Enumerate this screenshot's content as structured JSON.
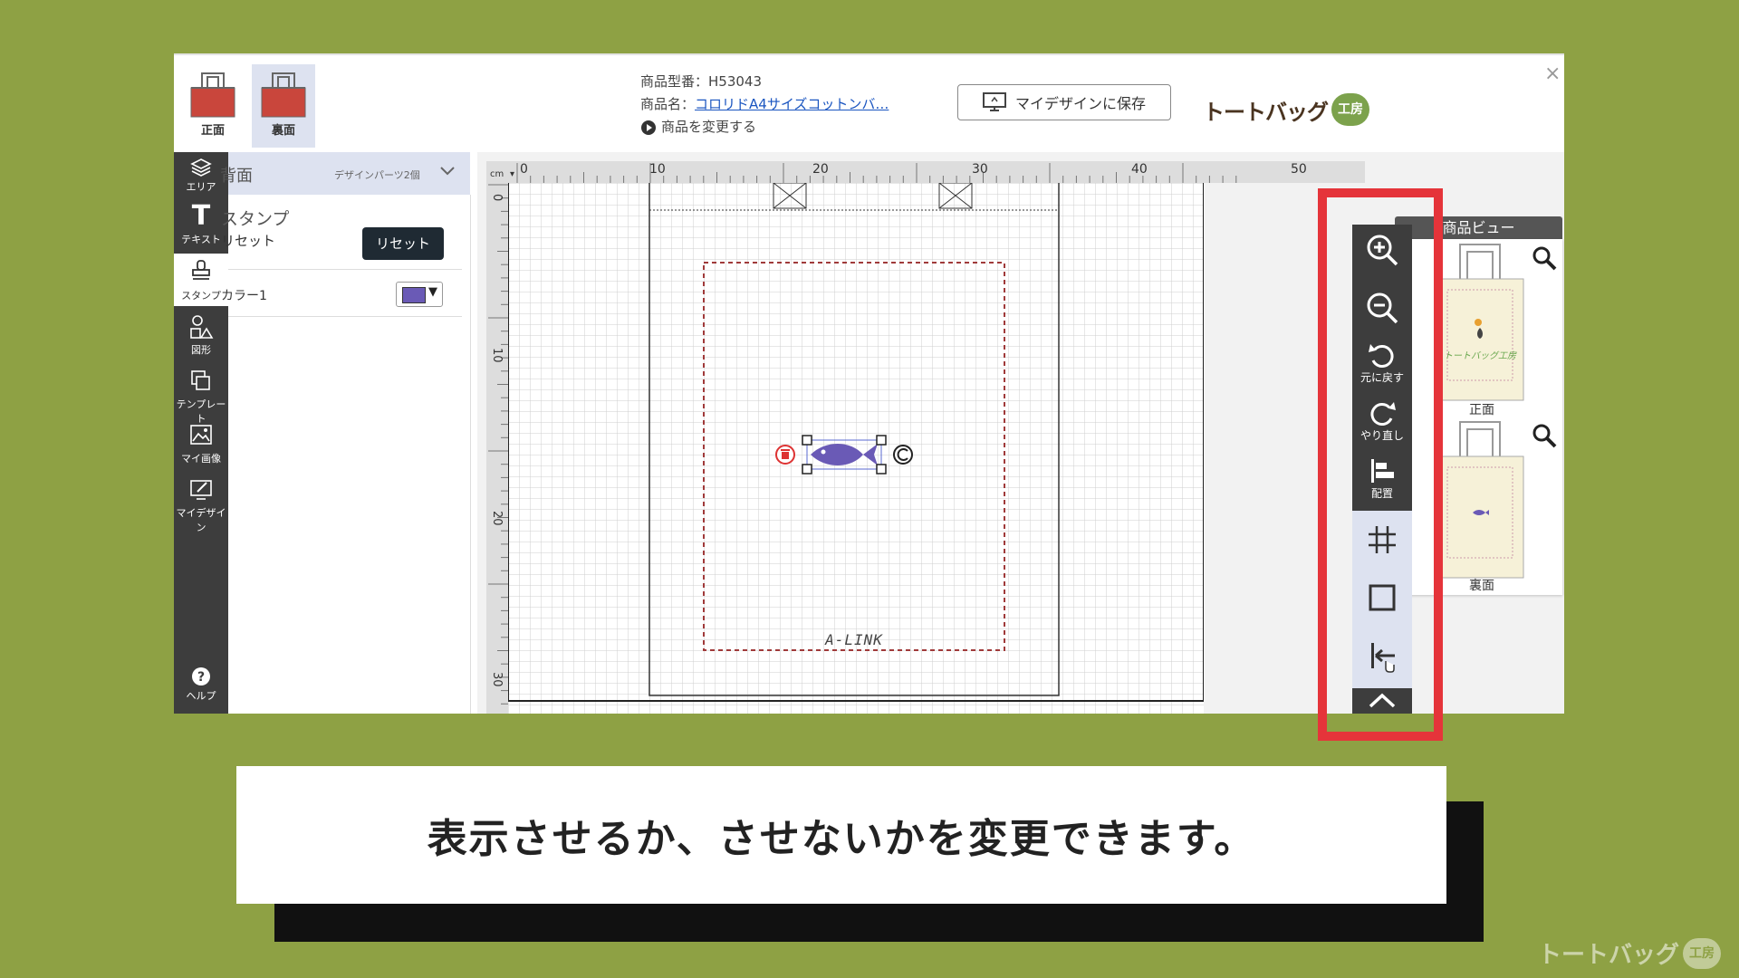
{
  "header": {
    "view_tabs": [
      {
        "label": "正面"
      },
      {
        "label": "裏面"
      }
    ],
    "product_code": "商品型番：H53043",
    "product_name_prefix": "商品名：",
    "product_name_link": "コロリドA4サイズコットンバ…",
    "change_product": "商品を変更する",
    "save_button": "マイデザインに保存",
    "logo_text": "トートバッグ",
    "logo_badge": "工房"
  },
  "iconbar": {
    "area": "エリア",
    "text": "テキスト",
    "stamp": "スタンプ",
    "shape": "図形",
    "template": "テンプレート",
    "my_image": "マイ画像",
    "my_design": "マイデザイン",
    "help": "ヘルプ"
  },
  "panel": {
    "area_title": "背面",
    "parts_count": "デザインパーツ2個",
    "section_title": "スタンプ",
    "reset_label": "リセット",
    "reset_button": "リセット",
    "color_label": "カラー1",
    "color_value": "#6a5ab6"
  },
  "canvas": {
    "unit": "cm",
    "ruler_h_ticks": [
      "0",
      "10",
      "20",
      "30",
      "40",
      "50"
    ],
    "ruler_v_ticks": [
      "0",
      "10",
      "20",
      "30"
    ],
    "bottom_text": "A-LINK"
  },
  "toolbar": {
    "undo": "元に戻す",
    "redo": "やり直し",
    "align": "配置"
  },
  "product_view": {
    "title": "商品ビュー",
    "front": "正面",
    "back": "裏面",
    "front_bag_text": "トートバッグ工房"
  },
  "caption": "表示させるか、させないかを変更できます。",
  "watermark": {
    "text": "トートバッグ",
    "badge": "工房"
  },
  "colors": {
    "background": "#8ea144",
    "highlight": "#e5343a",
    "bag_red": "#c9463c",
    "stamp_purple": "#6a5ab6"
  }
}
